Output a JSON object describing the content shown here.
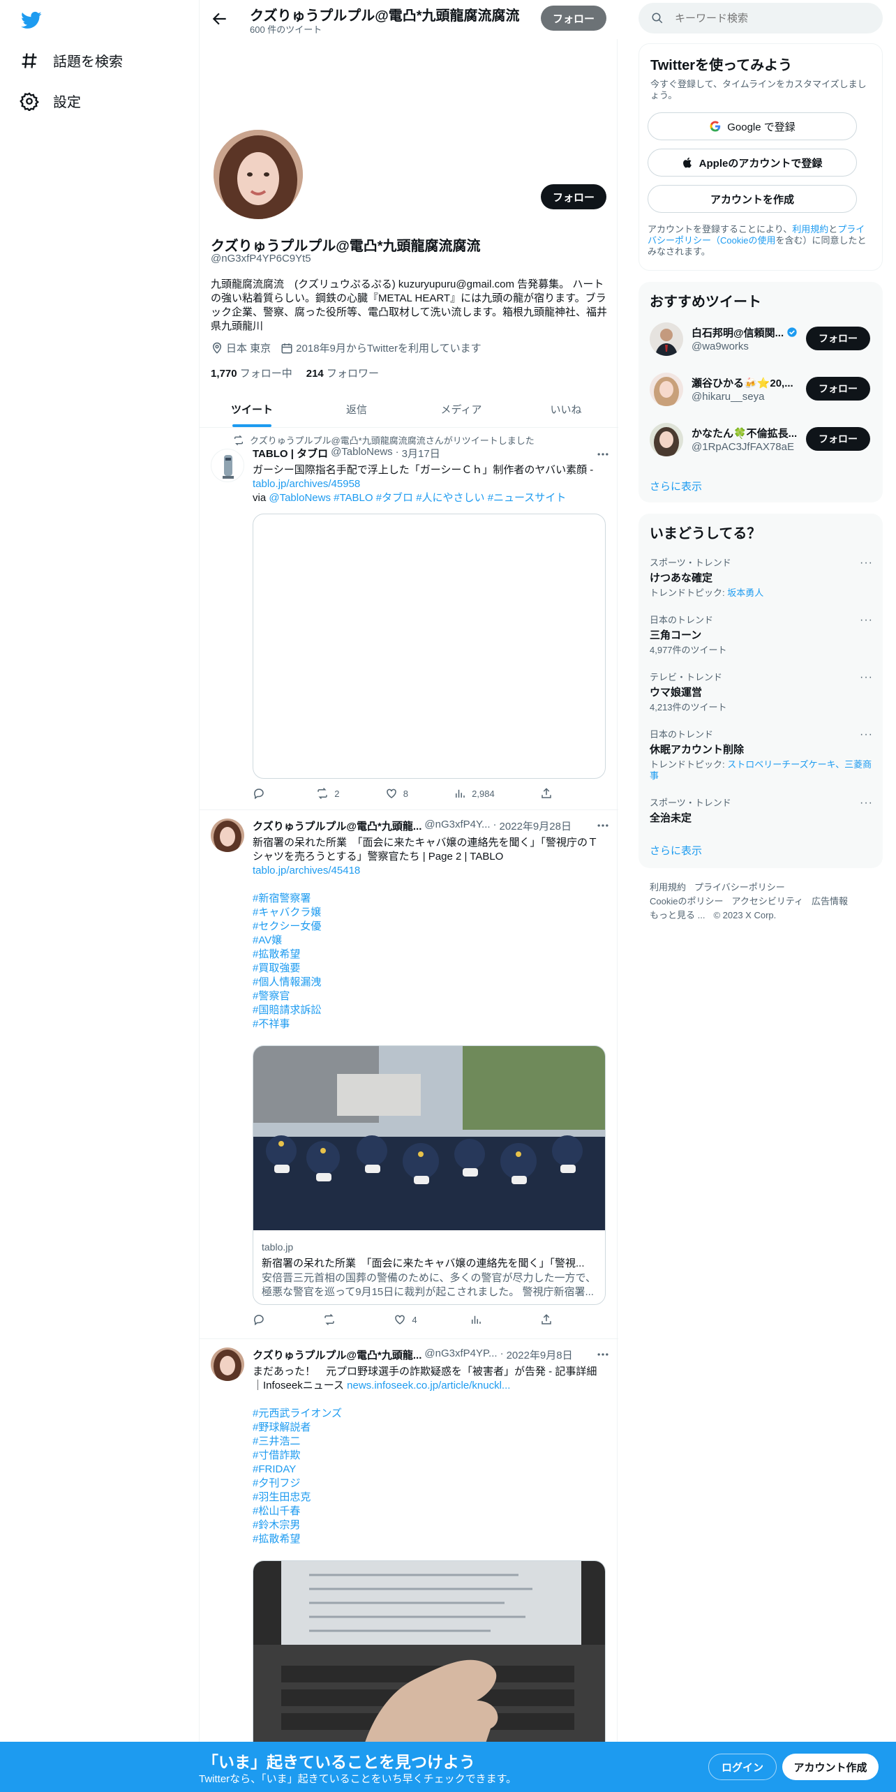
{
  "nav": {
    "explore_label": "話題を検索",
    "settings_label": "設定"
  },
  "header": {
    "title": "クズりゅうプルプル@電凸*九頭龍腐流腐流",
    "tweet_count": "600 件のツイート",
    "follow_label": "フォロー"
  },
  "profile": {
    "name": "クズりゅうプルプル@電凸*九頭龍腐流腐流",
    "handle": "@nG3xfP4YP6C9Yt5",
    "bio": "九頭龍腐流腐流　(クズリュウぷるぷる) kuzuryupuru@gmail.com 告発募集。 ハートの強い粘着質らしい。鋼鉄の心臓『METAL HEART』には九頭の龍が宿ります。ブラック企業、警察、腐った役所等、電凸取材して洗い流します。箱根九頭龍神社、福井県九頭龍川",
    "location": "日本 東京",
    "joined": "2018年9月からTwitterを利用しています",
    "following_count": "1,770",
    "following_label": "フォロー中",
    "followers_count": "214",
    "followers_label": "フォロワー",
    "follow_label": "フォロー"
  },
  "tabs": [
    {
      "label": "ツイート",
      "active": true
    },
    {
      "label": "返信",
      "active": false
    },
    {
      "label": "メディア",
      "active": false
    },
    {
      "label": "いいね",
      "active": false
    }
  ],
  "tweets": [
    {
      "retweet_note": "クズりゅうプルプル@電凸*九頭龍腐流腐流さんがリツイートしました",
      "name": "TABLO | タブロ",
      "handle": "@TabloNews",
      "date": "3月17日",
      "text": "ガーシー国際指名手配で浮上した「ガーシーＣｈ」制作者のヤバい素顔 -",
      "link": "tablo.jp/archives/45958",
      "via_prefix": " via",
      "via_tags": "@TabloNews #TABLO #タブロ #人にやさしい #ニュースサイト",
      "replies": "",
      "retweets": "2",
      "likes": "8",
      "views": "2,984"
    },
    {
      "name": "クズりゅうプルプル@電凸*九頭龍...",
      "handle": "@nG3xfP4Y...",
      "date": "2022年9月28日",
      "text": "新宿署の呆れた所業　「面会に来たキャバ嬢の連絡先を聞く」「警視庁のＴシャツを売ろうとする」警察官たち | Page 2 | TABLO",
      "link": "tablo.jp/archives/45418",
      "hashtags": [
        "#新宿警察署",
        "#キャバクラ嬢",
        "#セクシー女優",
        "#AV嬢",
        "#拡散希望",
        "#買取強要",
        "#個人情報漏洩",
        "#警察官",
        "#国賠請求訴訟",
        "#不祥事"
      ],
      "card_domain": "tablo.jp",
      "card_title": "新宿署の呆れた所業　「面会に来たキャバ嬢の連絡先を聞く」「警視...",
      "card_desc": "安倍晋三元首相の国葬の警備のために、多くの警官が尽力した一方で、極悪な警官を巡って9月15日に裁判が起こされました。 警視庁新宿署...",
      "replies": "",
      "retweets": "",
      "likes": "4",
      "views": ""
    },
    {
      "name": "クズりゅうプルプル@電凸*九頭龍...",
      "handle": "@nG3xfP4YP...",
      "date": "2022年9月8日",
      "text": "まだあった！　元プロ野球選手の詐欺疑惑を「被害者」が告発 - 記事詳細｜Infoseekニュース",
      "link": "news.infoseek.co.jp/article/knuckl...",
      "hashtags": [
        "#元西武ライオンズ",
        "#野球解説者",
        "#三井浩二",
        "#寸借詐欺",
        "#FRIDAY",
        "#夕刊フジ",
        "#羽生田忠克",
        "#松山千春",
        "#鈴木宗男",
        "#拡散希望"
      ]
    }
  ],
  "right": {
    "search_placeholder": "キーワード検索",
    "signup": {
      "title": "Twitterを使ってみよう",
      "subtitle": "今すぐ登録して、タイムラインをカスタマイズしましょう。",
      "google_label": "Google で登録",
      "apple_label": "Appleのアカウントで登録",
      "create_label": "アカウントを作成",
      "terms_prefix": "アカウントを登録することにより、",
      "terms_link": "利用規約",
      "terms_mid": "と",
      "privacy_link": "プライバシーポリシー（Cookieの使用",
      "terms_suffix": "を含む）に同意したとみなされます。"
    },
    "recommend": {
      "title": "おすすめツイート",
      "users": [
        {
          "name": "白石邦明@信頼関...",
          "handle": "@wa9works",
          "verified": true
        },
        {
          "name": "瀬谷ひかる🍻⭐20,...",
          "handle": "@hikaru__seya",
          "verified": false
        },
        {
          "name": "かなたん🍀不倫拡長...",
          "handle": "@1RpAC3JfFAX78aE",
          "verified": false
        }
      ],
      "follow_label": "フォロー",
      "more_label": "さらに表示"
    },
    "trends": {
      "title": "いまどうしてる？",
      "items": [
        {
          "context": "スポーツ・トレンド",
          "name": "けつあな確定",
          "sub_prefix": "トレンドトピック: ",
          "sub_link": "坂本勇人",
          "sub": ""
        },
        {
          "context": "日本のトレンド",
          "name": "三角コーン",
          "sub_prefix": "",
          "sub_link": "",
          "sub": "4,977件のツイート"
        },
        {
          "context": "テレビ・トレンド",
          "name": "ウマ娘運営",
          "sub_prefix": "",
          "sub_link": "",
          "sub": "4,213件のツイート"
        },
        {
          "context": "日本のトレンド",
          "name": "休眠アカウント削除",
          "sub_prefix": "トレンドトピック: ",
          "sub_link": "ストロベリーチーズケーキ、三菱商事",
          "sub": ""
        },
        {
          "context": "スポーツ・トレンド",
          "name": "全治未定",
          "sub_prefix": "",
          "sub_link": "",
          "sub": ""
        }
      ],
      "more_label": "さらに表示"
    },
    "footer": {
      "line1": [
        "利用規約",
        "プライバシーポリシー"
      ],
      "line2": [
        "Cookieのポリシー",
        "アクセシビリティ",
        "広告情報"
      ],
      "more": "もっと見る ...",
      "copyright": "© 2023 X Corp."
    }
  },
  "bottombar": {
    "title": "「いま」起きていることを見つけよう",
    "subtitle": "Twitterなら、「いま」起きていることをいち早くチェックできます。",
    "login_label": "ログイン",
    "signup_label": "アカウント作成"
  },
  "colors": {
    "accent": "#1d9bf0",
    "text": "#0f1419",
    "muted": "#536471"
  }
}
